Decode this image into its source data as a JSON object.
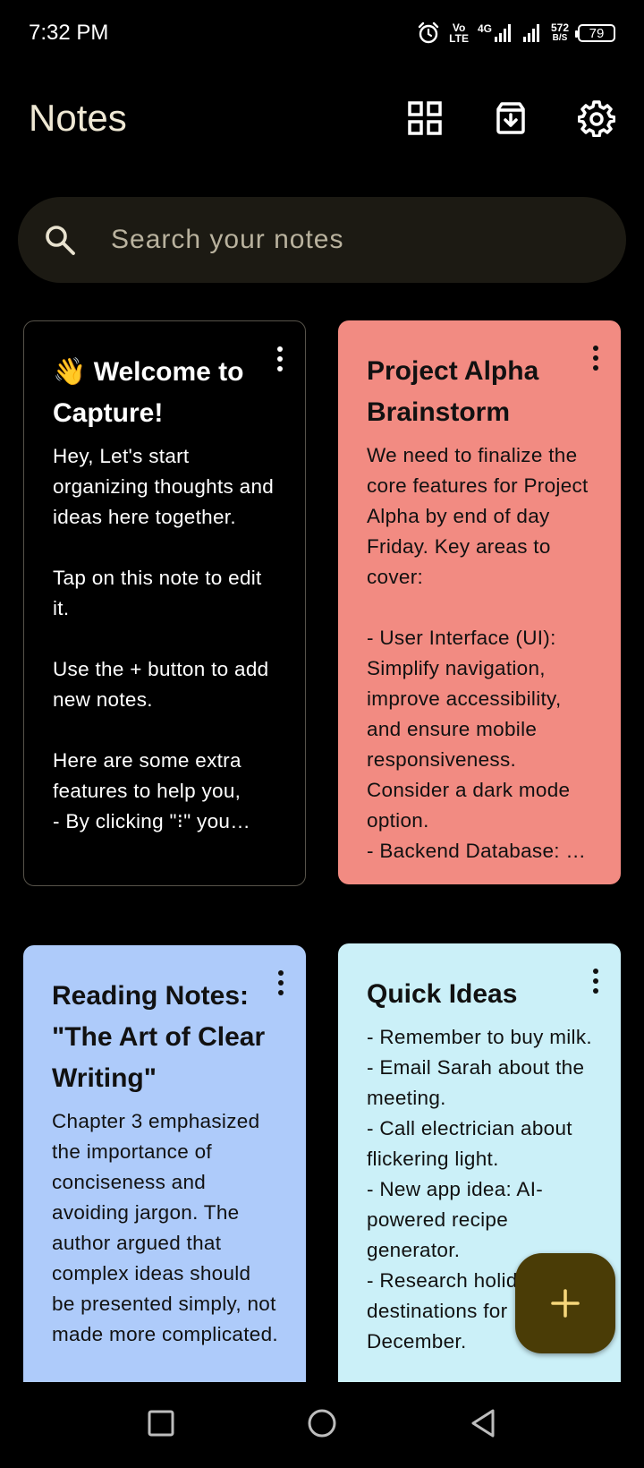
{
  "status_bar": {
    "time": "7:32 PM",
    "network_volte_top": "Vo",
    "network_volte_bottom": "LTE",
    "network_type": "4G",
    "network_speed_value": "572",
    "network_speed_unit": "B/S",
    "battery_level": "79"
  },
  "header": {
    "title": "Notes",
    "icons": [
      "grid-view-icon",
      "archive-download-icon",
      "settings-gear-icon"
    ]
  },
  "search": {
    "placeholder": "Search your notes",
    "value": ""
  },
  "notes": [
    {
      "title": "👋 Welcome to Capture!",
      "body": "Hey, Let's start organizing thoughts and ideas here together.\n\nTap on this note to edit it.\n\nUse the + button to add new notes.\n\nHere are some extra features to help you,\n    - By clicking \"⁝\" you…",
      "color": "#000000"
    },
    {
      "title": "Project Alpha Brainstorm",
      "body": "We need to finalize the core features for Project Alpha by end of day Friday. Key areas to cover:\n\n- User Interface (UI): Simplify navigation, improve accessibility, and ensure mobile responsiveness. Consider a dark mode option.\n- Backend Database: …",
      "color": "#f28b82"
    },
    {
      "title": "Reading Notes: \"The Art of Clear Writing\"",
      "body": "Chapter 3 emphasized the importance of conciseness and avoiding jargon. The author argued that complex ideas should be presented simply, not made more complicated.",
      "color": "#aecbfa"
    },
    {
      "title": "Quick Ideas",
      "body": "- Remember to buy milk.\n- Email Sarah about the meeting.\n- Call electrician about flickering light.\n- New app idea: AI-powered recipe generator.\n- Research holiday destinations for December.",
      "color": "#cbf0f8"
    }
  ],
  "fab": {
    "icon": "plus-icon",
    "color": "#4a3c06",
    "icon_color": "#f6d67a"
  },
  "nav_bar": {
    "icons": [
      "recents-square-icon",
      "home-circle-icon",
      "back-triangle-icon"
    ]
  }
}
